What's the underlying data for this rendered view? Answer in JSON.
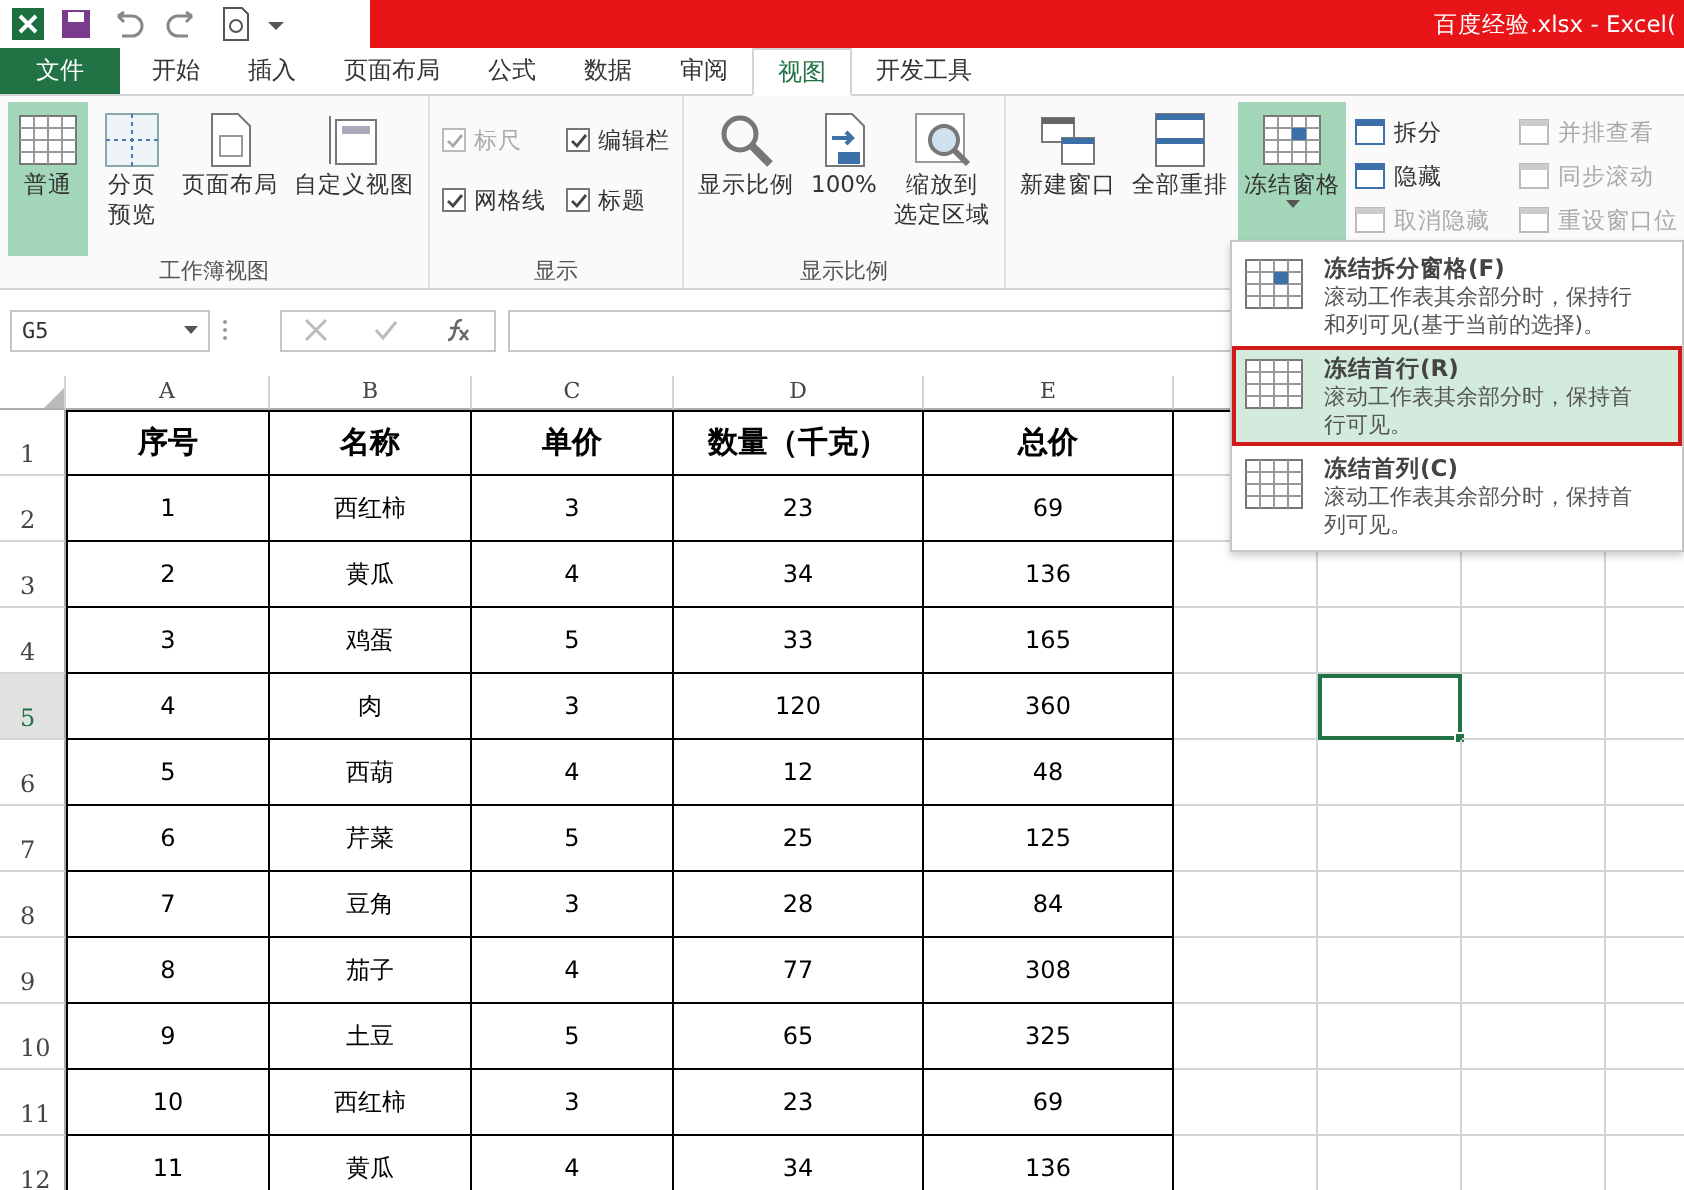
{
  "window": {
    "title": "百度经验.xlsx - Excel("
  },
  "tabs": [
    {
      "label": "文件",
      "kind": "file",
      "selected": false
    },
    {
      "label": "开始",
      "kind": "tab",
      "selected": false
    },
    {
      "label": "插入",
      "kind": "tab",
      "selected": false
    },
    {
      "label": "页面布局",
      "kind": "tab",
      "selected": false
    },
    {
      "label": "公式",
      "kind": "tab",
      "selected": false
    },
    {
      "label": "数据",
      "kind": "tab",
      "selected": false
    },
    {
      "label": "审阅",
      "kind": "tab",
      "selected": false
    },
    {
      "label": "视图",
      "kind": "tab",
      "selected": true
    },
    {
      "label": "开发工具",
      "kind": "tab",
      "selected": false
    }
  ],
  "ribbon": [
    {
      "label": "工作簿视图",
      "items": [
        {
          "kind": "large",
          "lines": [
            "普通"
          ],
          "selected": true
        },
        {
          "kind": "large",
          "lines": [
            "分页",
            "预览"
          ],
          "selected": false
        },
        {
          "kind": "large",
          "lines": [
            "页面布局"
          ],
          "selected": false
        },
        {
          "kind": "large",
          "lines": [
            "自定义视图"
          ],
          "selected": false
        }
      ]
    },
    {
      "label": "显示",
      "items": [
        {
          "kind": "checkbox",
          "label": "标尺",
          "checked": true,
          "disabled": true
        },
        {
          "kind": "checkbox",
          "label": "编辑栏",
          "checked": true,
          "disabled": false
        },
        {
          "kind": "checkbox",
          "label": "网格线",
          "checked": true,
          "disabled": false
        },
        {
          "kind": "checkbox",
          "label": "标题",
          "checked": true,
          "disabled": false
        }
      ]
    },
    {
      "label": "显示比例",
      "items": [
        {
          "kind": "large",
          "lines": [
            "显示比例"
          ],
          "selected": false
        },
        {
          "kind": "large",
          "lines": [
            "100%"
          ],
          "selected": false
        },
        {
          "kind": "large",
          "lines": [
            "缩放到",
            "选定区域"
          ],
          "selected": false
        }
      ]
    },
    {
      "items": [
        {
          "kind": "large",
          "lines": [
            "新建窗口"
          ],
          "selected": false
        },
        {
          "kind": "large",
          "lines": [
            "全部重排"
          ],
          "selected": false
        },
        {
          "kind": "large",
          "lines": [
            "冻结窗格"
          ],
          "selected": true,
          "dropdown": true
        },
        {
          "kind": "small",
          "label": "拆分",
          "disabled": false
        },
        {
          "kind": "small",
          "label": "隐藏",
          "disabled": false
        },
        {
          "kind": "small",
          "label": "取消隐藏",
          "disabled": true
        },
        {
          "kind": "small",
          "label": "并排查看",
          "disabled": true
        },
        {
          "kind": "small",
          "label": "同步滚动",
          "disabled": true
        },
        {
          "kind": "small",
          "label": "重设窗口位",
          "disabled": true
        }
      ]
    }
  ],
  "formula_bar": {
    "name_box": "G5"
  },
  "sheet": {
    "columns": [
      {
        "label": "A",
        "selected": false
      },
      {
        "label": "B",
        "selected": false
      },
      {
        "label": "C",
        "selected": false
      },
      {
        "label": "D",
        "selected": false
      },
      {
        "label": "E",
        "selected": false
      },
      {
        "selected": false
      },
      {
        "selected": true
      }
    ],
    "rows": [
      {
        "number": "1",
        "kind": "header",
        "selected": false,
        "cells": [
          "序号",
          "名称",
          "单价",
          "数量（千克）",
          "总价"
        ]
      },
      {
        "number": "2",
        "kind": "data",
        "selected": false,
        "cells": [
          "1",
          "西红柿",
          "3",
          "23",
          "69"
        ]
      },
      {
        "number": "3",
        "kind": "data",
        "selected": false,
        "cells": [
          "2",
          "黄瓜",
          "4",
          "34",
          "136"
        ]
      },
      {
        "number": "4",
        "kind": "data",
        "selected": false,
        "cells": [
          "3",
          "鸡蛋",
          "5",
          "33",
          "165"
        ]
      },
      {
        "number": "5",
        "kind": "data",
        "selected": true,
        "cells": [
          "4",
          "肉",
          "3",
          "120",
          "360"
        ]
      },
      {
        "number": "6",
        "kind": "data",
        "selected": false,
        "cells": [
          "5",
          "西葫",
          "4",
          "12",
          "48"
        ]
      },
      {
        "number": "7",
        "kind": "data",
        "selected": false,
        "cells": [
          "6",
          "芹菜",
          "5",
          "25",
          "125"
        ]
      },
      {
        "number": "8",
        "kind": "data",
        "selected": false,
        "cells": [
          "7",
          "豆角",
          "3",
          "28",
          "84"
        ]
      },
      {
        "number": "9",
        "kind": "data",
        "selected": false,
        "cells": [
          "8",
          "茄子",
          "4",
          "77",
          "308"
        ]
      },
      {
        "number": "10",
        "kind": "data",
        "selected": false,
        "cells": [
          "9",
          "土豆",
          "5",
          "65",
          "325"
        ]
      },
      {
        "number": "11",
        "kind": "data",
        "selected": false,
        "cells": [
          "10",
          "西红柿",
          "3",
          "23",
          "69"
        ]
      },
      {
        "number": "12",
        "kind": "data",
        "selected": false,
        "cells": [
          "11",
          "黄瓜",
          "4",
          "34",
          "136"
        ]
      }
    ]
  },
  "menu": [
    {
      "title": "冻结拆分窗格(F)",
      "description": "滚动工作表其余部分时，保持行和列可见(基于当前的选择)。",
      "selected": false
    },
    {
      "title": "冻结首行(R)",
      "description": "滚动工作表其余部分时，保持首行可见。",
      "selected": true
    },
    {
      "title": "冻结首列(C)",
      "description": "滚动工作表其余部分时，保持首列可见。",
      "selected": false
    }
  ]
}
